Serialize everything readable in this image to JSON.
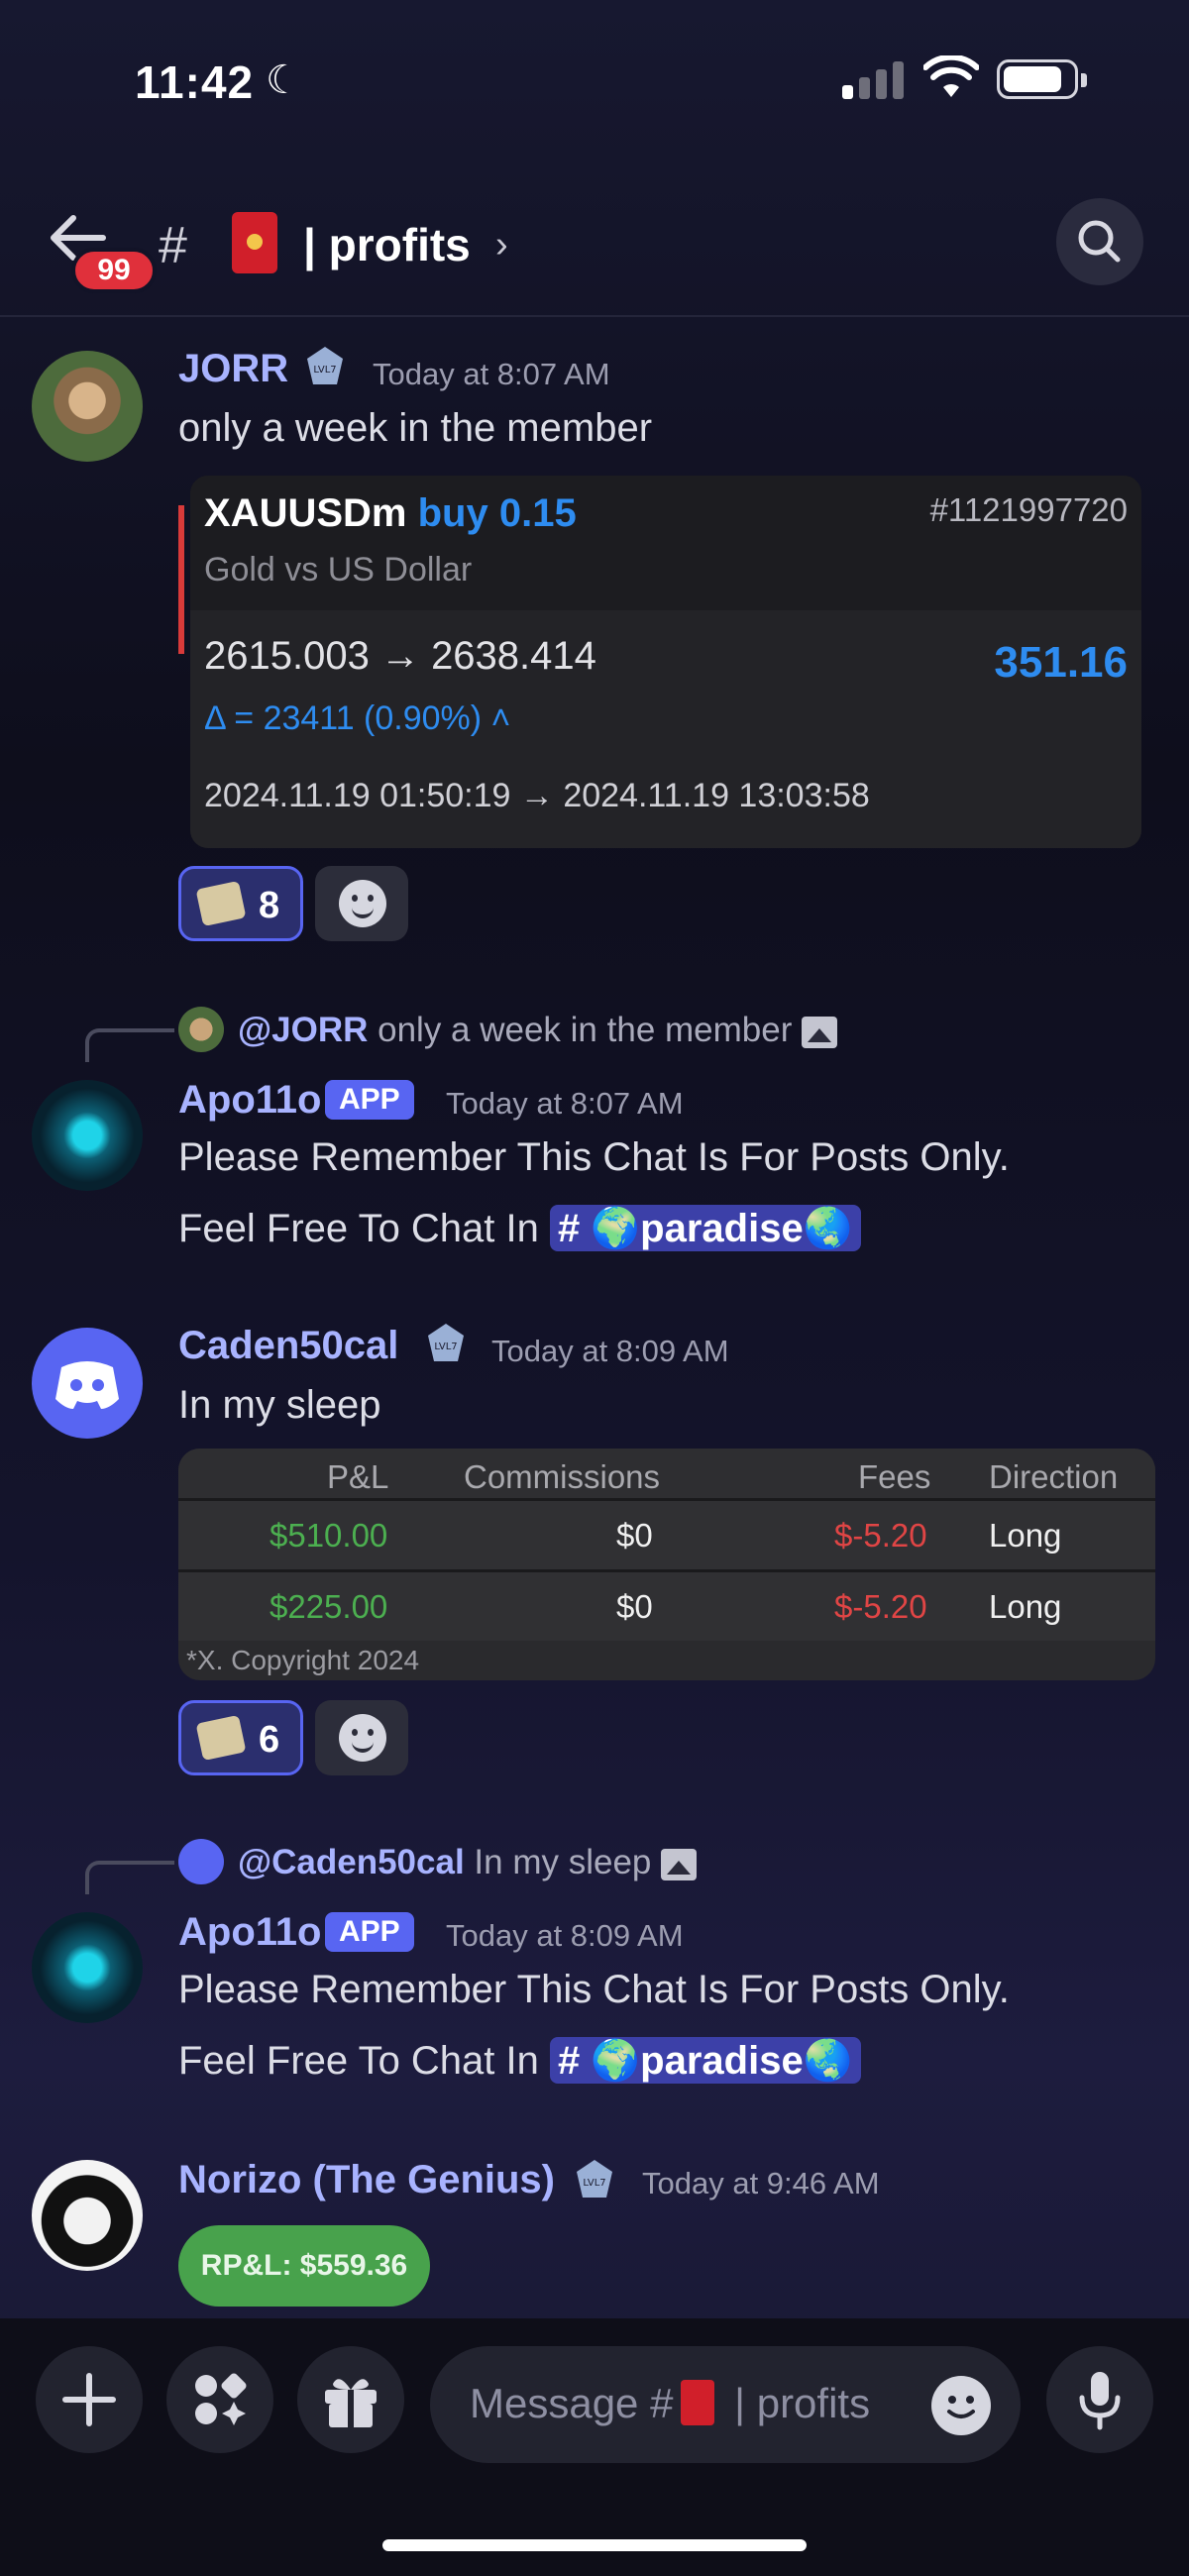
{
  "status": {
    "time": "11:42",
    "moon": "☾"
  },
  "header": {
    "badge": "99",
    "hash": "#",
    "title": "| profits",
    "chevron": "›"
  },
  "messages": [
    {
      "user": "JORR",
      "time": "Today at 8:07 AM",
      "text": "only a week in the member",
      "trade": {
        "symbol": "XAUUSDm",
        "side": "buy 0.15",
        "id": "#1121997720",
        "desc": "Gold vs US Dollar",
        "prices": "2615.003 → 2638.414",
        "profit": "351.16",
        "delta": "Δ = 23411 (0.90%) ˄",
        "dates": "2024.11.19 01:50:19 → 2024.11.19 13:03:58"
      },
      "reaction_count": "8"
    },
    {
      "reply": {
        "user": "@JORR",
        "text": "only a week in the member"
      },
      "user": "Apo11o",
      "tag": "APP",
      "time": "Today at 8:07 AM",
      "line1": "Please Remember This Chat Is For Posts Only.",
      "line2": "Feel Free To Chat In",
      "channel": "# 🌍paradise🌏"
    },
    {
      "user": "Caden50cal",
      "time": "Today at 8:09 AM",
      "text": "In my sleep",
      "table": {
        "headers": [
          "P&L",
          "Commissions",
          "Fees",
          "Direction"
        ],
        "rows": [
          [
            "$510.00",
            "$0",
            "$-5.20",
            "Long"
          ],
          [
            "$225.00",
            "$0",
            "$-5.20",
            "Long"
          ]
        ],
        "footer": "*X. Copyright 2024"
      },
      "reaction_count": "6"
    },
    {
      "reply": {
        "user": "@Caden50cal",
        "text": "In my sleep"
      },
      "user": "Apo11o",
      "tag": "APP",
      "time": "Today at 8:09 AM",
      "line1": "Please Remember This Chat Is For Posts Only.",
      "line2": "Feel Free To Chat In",
      "channel": "# 🌍paradise🌏"
    },
    {
      "user": "Norizo (The Genius)",
      "time": "Today at 9:46 AM",
      "image_text": "RP&L: $559.36"
    }
  ],
  "composer": {
    "placeholder_prefix": "Message #",
    "placeholder_suffix": "| profits"
  },
  "colors": {
    "accent": "#5865f2",
    "username": "#a8b3ff",
    "profit_blue": "#2e8cf0",
    "gain_green": "#4caf50",
    "loss_red": "#e04545"
  }
}
